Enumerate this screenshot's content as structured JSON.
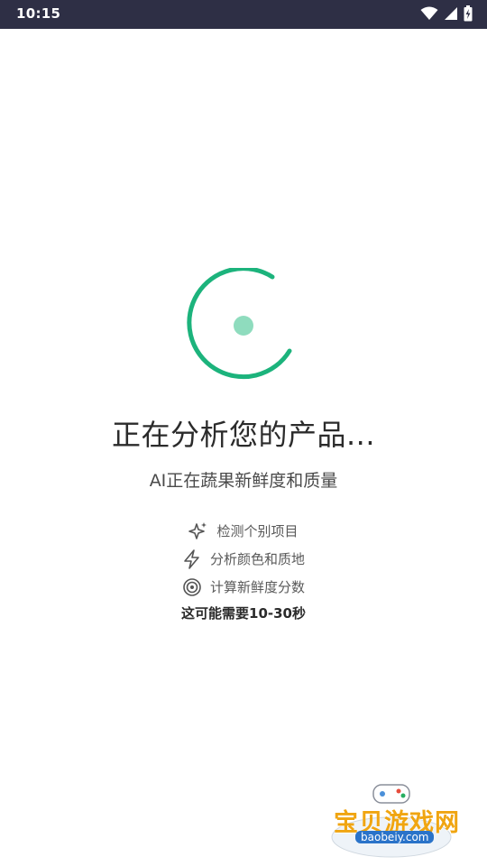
{
  "status_bar": {
    "time": "10:15"
  },
  "loading": {
    "title": "正在分析您的产品...",
    "subtitle": "AI正在蔬果新鲜度和质量",
    "steps": [
      {
        "icon": "sparkle-icon",
        "label": "检测个别项目"
      },
      {
        "icon": "lightning-icon",
        "label": "分析颜色和质地"
      },
      {
        "icon": "target-icon",
        "label": "计算新鲜度分数"
      }
    ],
    "note": "这可能需要10-30秒"
  },
  "watermark": {
    "name": "宝贝游戏网",
    "url": "baobeiy.com"
  },
  "colors": {
    "accent": "#1cb37c",
    "accent_light": "#8fdcbe",
    "status_bar": "#2e2f45"
  }
}
